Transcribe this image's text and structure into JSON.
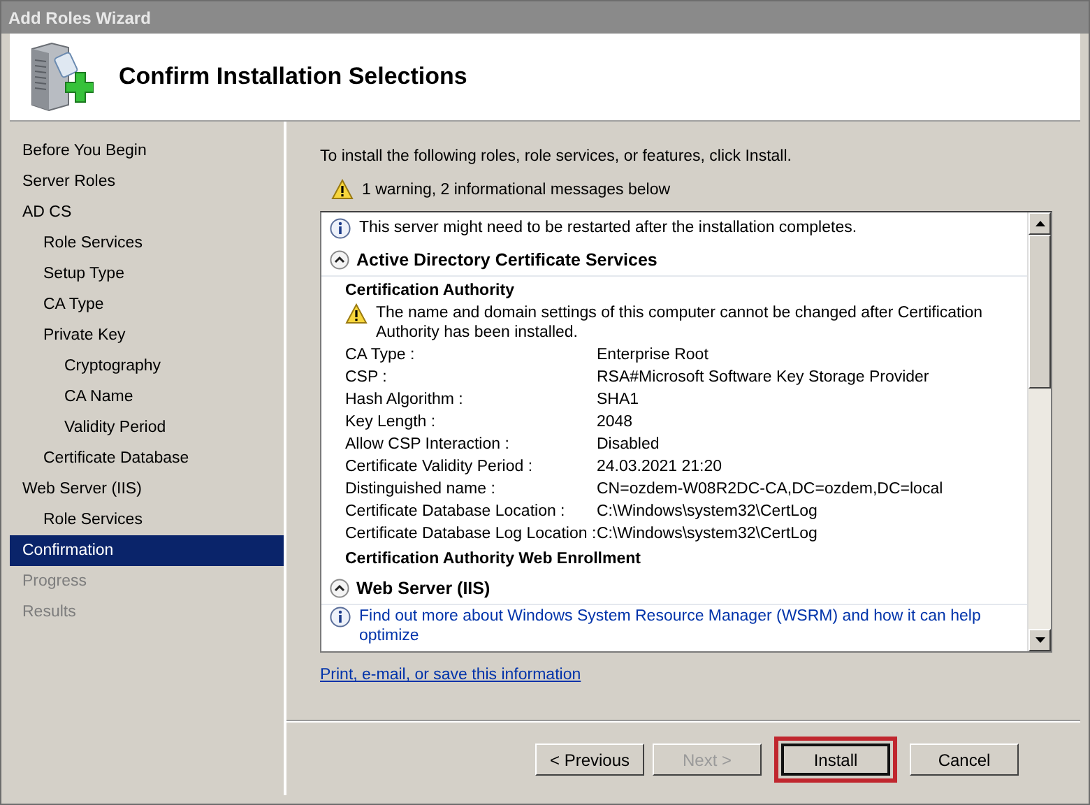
{
  "window": {
    "title": "Add Roles Wizard"
  },
  "header": {
    "title": "Confirm Installation Selections"
  },
  "sidebar": {
    "items": [
      {
        "label": "Before You Begin",
        "selected": false,
        "disabled": false
      },
      {
        "label": "Server Roles",
        "selected": false,
        "disabled": false
      },
      {
        "label": "AD CS",
        "selected": false,
        "disabled": false,
        "children": [
          {
            "label": "Role Services",
            "selected": false,
            "disabled": false
          },
          {
            "label": "Setup Type",
            "selected": false,
            "disabled": false
          },
          {
            "label": "CA Type",
            "selected": false,
            "disabled": false
          },
          {
            "label": "Private Key",
            "selected": false,
            "disabled": false,
            "children": [
              {
                "label": "Cryptography",
                "selected": false,
                "disabled": false
              },
              {
                "label": "CA Name",
                "selected": false,
                "disabled": false
              },
              {
                "label": "Validity Period",
                "selected": false,
                "disabled": false
              }
            ]
          },
          {
            "label": "Certificate Database",
            "selected": false,
            "disabled": false
          }
        ]
      },
      {
        "label": "Web Server (IIS)",
        "selected": false,
        "disabled": false,
        "children": [
          {
            "label": "Role Services",
            "selected": false,
            "disabled": false
          }
        ]
      },
      {
        "label": "Confirmation",
        "selected": true,
        "disabled": false
      },
      {
        "label": "Progress",
        "selected": false,
        "disabled": true
      },
      {
        "label": "Results",
        "selected": false,
        "disabled": true
      }
    ]
  },
  "intro": "To install the following roles, role services, or features, click Install.",
  "summary": "1 warning, 2 informational messages below",
  "details": {
    "items": [
      {
        "kind": "info",
        "text": "This server might need to be restarted after the installation completes."
      },
      {
        "kind": "section",
        "title": "Active Directory Certificate Services",
        "expanded": true
      },
      {
        "kind": "subheading",
        "text": "Certification Authority"
      },
      {
        "kind": "warning",
        "text": "The name and domain settings of this computer cannot be changed after Certification Authority has been installed."
      },
      {
        "kind": "property",
        "label": "CA Type :",
        "value": "Enterprise Root"
      },
      {
        "kind": "property",
        "label": "CSP :",
        "value": "RSA#Microsoft Software Key Storage Provider"
      },
      {
        "kind": "property",
        "label": "Hash Algorithm :",
        "value": "SHA1"
      },
      {
        "kind": "property",
        "label": "Key Length :",
        "value": "2048"
      },
      {
        "kind": "property",
        "label": "Allow CSP Interaction :",
        "value": "Disabled"
      },
      {
        "kind": "property",
        "label": "Certificate Validity Period :",
        "value": "24.03.2021 21:20"
      },
      {
        "kind": "property",
        "label": "Distinguished name :",
        "value": "CN=ozdem-W08R2DC-CA,DC=ozdem,DC=local"
      },
      {
        "kind": "property",
        "label": "Certificate Database Location :",
        "value": "C:\\Windows\\system32\\CertLog"
      },
      {
        "kind": "property",
        "label": "Certificate Database Log Location :",
        "value": "C:\\Windows\\system32\\CertLog"
      },
      {
        "kind": "subheading",
        "text": "Certification Authority Web Enrollment"
      },
      {
        "kind": "section",
        "title": "Web Server (IIS)",
        "expanded": true
      },
      {
        "kind": "infolink",
        "text": "Find out more about Windows System Resource Manager (WSRM) and how it can help optimize"
      }
    ]
  },
  "link": "Print, e-mail, or save this information",
  "buttons": [
    {
      "label": "< Previous",
      "disabled": false,
      "highlighted": false
    },
    {
      "label": "Next >",
      "disabled": true,
      "highlighted": false
    },
    {
      "label": "Install",
      "disabled": false,
      "highlighted": true
    },
    {
      "label": "Cancel",
      "disabled": false,
      "highlighted": false
    }
  ]
}
